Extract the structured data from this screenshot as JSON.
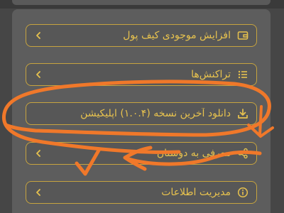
{
  "colors": {
    "background": "#464646",
    "panel": "#5d5d5d",
    "accent": "#e7c24e",
    "border": "#c7a43f",
    "annotation": "#f0782a"
  },
  "menu": {
    "items": [
      {
        "label": "افزایش موجودی کیف پول",
        "icon": "wallet-icon"
      },
      {
        "label": "تراکنش‌ها",
        "icon": "list-icon"
      },
      {
        "label": "دانلود آخرین نسخه (۱.۰.۴) اپلیکیشن",
        "icon": "download-icon"
      },
      {
        "label": "معرفی به دوستان",
        "icon": "share-icon"
      },
      {
        "label": "مدیریت اطلاعات",
        "icon": "info-icon"
      }
    ]
  }
}
